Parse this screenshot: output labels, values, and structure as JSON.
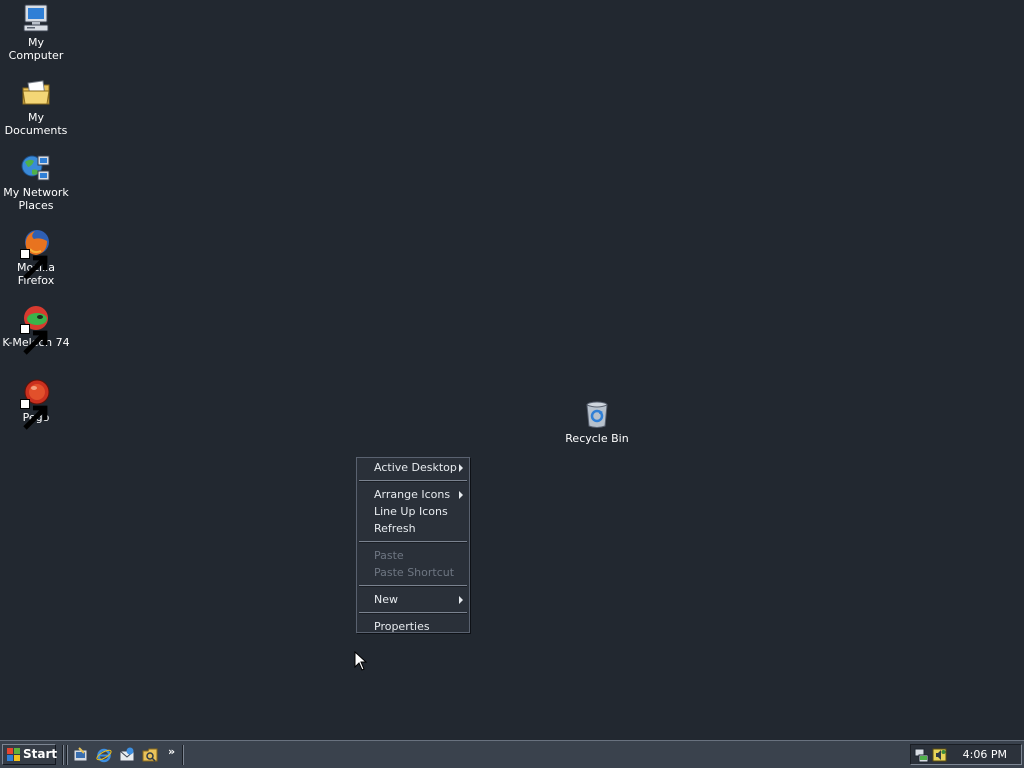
{
  "desktop": {
    "icons": [
      {
        "label": "My Computer",
        "icon": "my-computer-icon"
      },
      {
        "label": "My Documents",
        "icon": "my-documents-icon"
      },
      {
        "label": "My Network Places",
        "icon": "network-places-icon"
      },
      {
        "label": "Mozilla Firefox",
        "icon": "firefox-icon"
      },
      {
        "label": "K-Meleon 74",
        "icon": "k-meleon-icon"
      },
      {
        "label": "Pego",
        "icon": "pego-icon"
      },
      {
        "label": "Recycle Bin",
        "icon": "recycle-bin-icon"
      }
    ]
  },
  "context_menu": {
    "items": [
      {
        "label": "Active Desktop",
        "submenu": true,
        "enabled": true
      },
      {
        "label": "Arrange Icons",
        "submenu": true,
        "enabled": true
      },
      {
        "label": "Line Up Icons",
        "submenu": false,
        "enabled": true
      },
      {
        "label": "Refresh",
        "submenu": false,
        "enabled": true
      },
      {
        "label": "Paste",
        "submenu": false,
        "enabled": false
      },
      {
        "label": "Paste Shortcut",
        "submenu": false,
        "enabled": false
      },
      {
        "label": "New",
        "submenu": true,
        "enabled": true
      },
      {
        "label": "Properties",
        "submenu": false,
        "enabled": true
      }
    ]
  },
  "taskbar": {
    "start_label": "Start",
    "quick_launch": [
      "show-desktop-icon",
      "internet-explorer-icon",
      "outlook-express-icon",
      "windows-explorer-icon"
    ],
    "quick_launch_more": "»",
    "tray_icons": [
      "network-icon",
      "volume-icon"
    ],
    "clock": "4:06 PM"
  },
  "colors": {
    "desktop_background": "#222830",
    "taskbar_background": "#3a424d",
    "menu_background": "#2a3039"
  }
}
